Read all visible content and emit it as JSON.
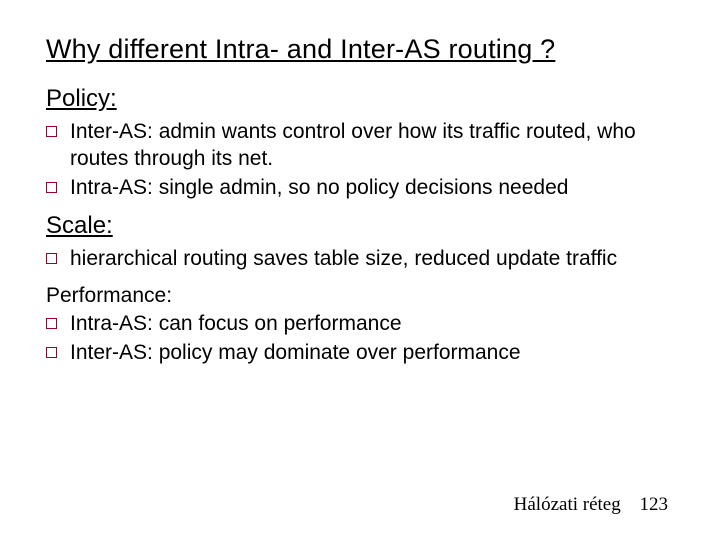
{
  "title": "Why different Intra- and Inter-AS routing ?",
  "sections": {
    "policy": {
      "heading": "Policy:",
      "items": [
        "Inter-AS: admin wants control over how its traffic routed, who routes through its net.",
        "Intra-AS: single admin, so no policy decisions needed"
      ]
    },
    "scale": {
      "heading": "Scale:",
      "items": [
        "hierarchical routing saves table size, reduced update traffic"
      ]
    },
    "performance": {
      "heading": "Performance:",
      "items": [
        "Intra-AS: can focus on performance",
        "Inter-AS: policy may dominate over performance"
      ]
    }
  },
  "footer": {
    "label": "Hálózati réteg",
    "page": "123"
  }
}
